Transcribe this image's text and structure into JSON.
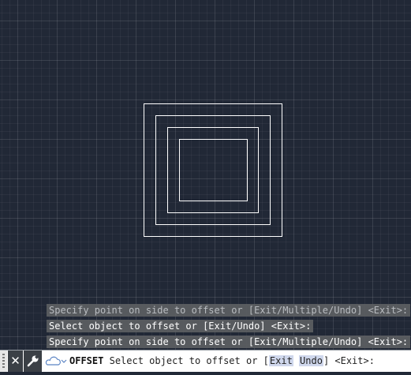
{
  "history": [
    "Specify point on side to offset or [Exit/Multiple/Undo] <Exit>:",
    "Select object to offset or [Exit/Undo] <Exit>:",
    "Specify point on side to offset or [Exit/Multiple/Undo] <Exit>:"
  ],
  "command_line": {
    "command": "OFFSET",
    "prompt_before": "Select object to offset or [",
    "options": [
      "Exit",
      "Undo"
    ],
    "prompt_after": "] <Exit>:"
  },
  "icons": {
    "close": "close-icon",
    "customize": "wrench-icon",
    "recent": "recent-commands-icon"
  },
  "colors": {
    "canvas": "#212836",
    "geometry": "#ffffff",
    "history_bg": "#5c5e62",
    "command_bar": "#ffffff",
    "option_highlight": "#cfd7ec"
  }
}
